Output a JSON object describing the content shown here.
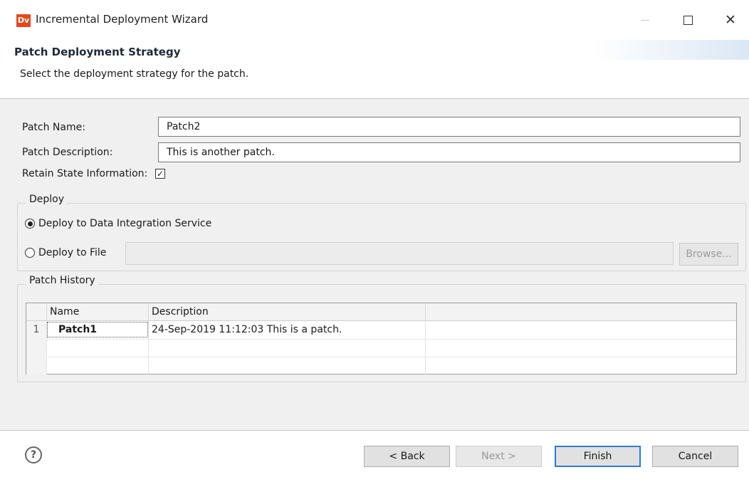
{
  "window": {
    "app_icon_text": "Dv",
    "title": "Incremental Deployment Wizard"
  },
  "header": {
    "title": "Patch Deployment Strategy",
    "description": "Select the deployment strategy for the patch."
  },
  "form": {
    "patch_name_label": "Patch Name:",
    "patch_name_value": "Patch2",
    "patch_description_label": "Patch Description:",
    "patch_description_value": "This is another patch.",
    "retain_state_label": "Retain State Information:",
    "retain_state_checked": true
  },
  "deploy": {
    "legend": "Deploy",
    "option_service_label": "Deploy to Data Integration Service",
    "option_service_selected": true,
    "option_file_label": "Deploy to File",
    "option_file_selected": false,
    "file_path_value": "",
    "browse_label": "Browse..."
  },
  "patch_history": {
    "legend": "Patch History",
    "columns": [
      "Name",
      "Description"
    ],
    "rows": [
      {
        "num": "1",
        "name": "Patch1",
        "description": "24-Sep-2019 11:12:03 This is a patch."
      }
    ]
  },
  "footer": {
    "help_symbol": "?",
    "back_label": "< Back",
    "next_label": "Next >",
    "finish_label": "Finish",
    "cancel_label": "Cancel"
  }
}
